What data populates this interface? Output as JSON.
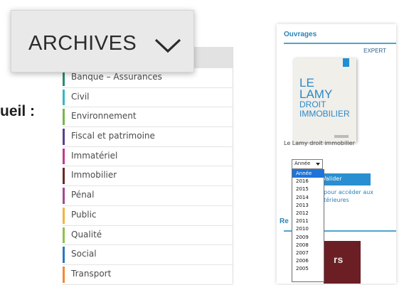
{
  "left_heading": "ueil :",
  "archives": {
    "label": "ARCHIVES",
    "icon": "chevron-down-icon"
  },
  "categories": [
    {
      "label": "Banque – Assurances",
      "color": "#2b8a6e"
    },
    {
      "label": "Civil",
      "color": "#36b6c9"
    },
    {
      "label": "Environnement",
      "color": "#74b847"
    },
    {
      "label": "Fiscal et patrimoine",
      "color": "#5b3f93"
    },
    {
      "label": "Immatériel",
      "color": "#c23a8e"
    },
    {
      "label": "Immobilier",
      "color": "#6e2a25"
    },
    {
      "label": "Pénal",
      "color": "#a34a92"
    },
    {
      "label": "Public",
      "color": "#f2b440"
    },
    {
      "label": "Qualité",
      "color": "#8fc24a"
    },
    {
      "label": "Social",
      "color": "#2a78c0"
    },
    {
      "label": "Transport",
      "color": "#f08a37"
    }
  ],
  "panel": {
    "title": "Ouvrages",
    "badge": "EXPERT",
    "book_lines": [
      "LE",
      "LAMY",
      "DROIT",
      "IMMOBILIER"
    ],
    "caption": "Le Lamy droit immobilier",
    "valider": "Valider",
    "link_lines": [
      "pour accéder aux",
      "térieures"
    ],
    "section2_title": "Re",
    "book2_text": "rs"
  },
  "year_select": {
    "value": "Année",
    "options": [
      "Année",
      "2016",
      "2015",
      "2014",
      "2013",
      "2012",
      "2011",
      "2010",
      "2009",
      "2008",
      "2007",
      "2006",
      "2005"
    ],
    "selected_index": 0
  }
}
